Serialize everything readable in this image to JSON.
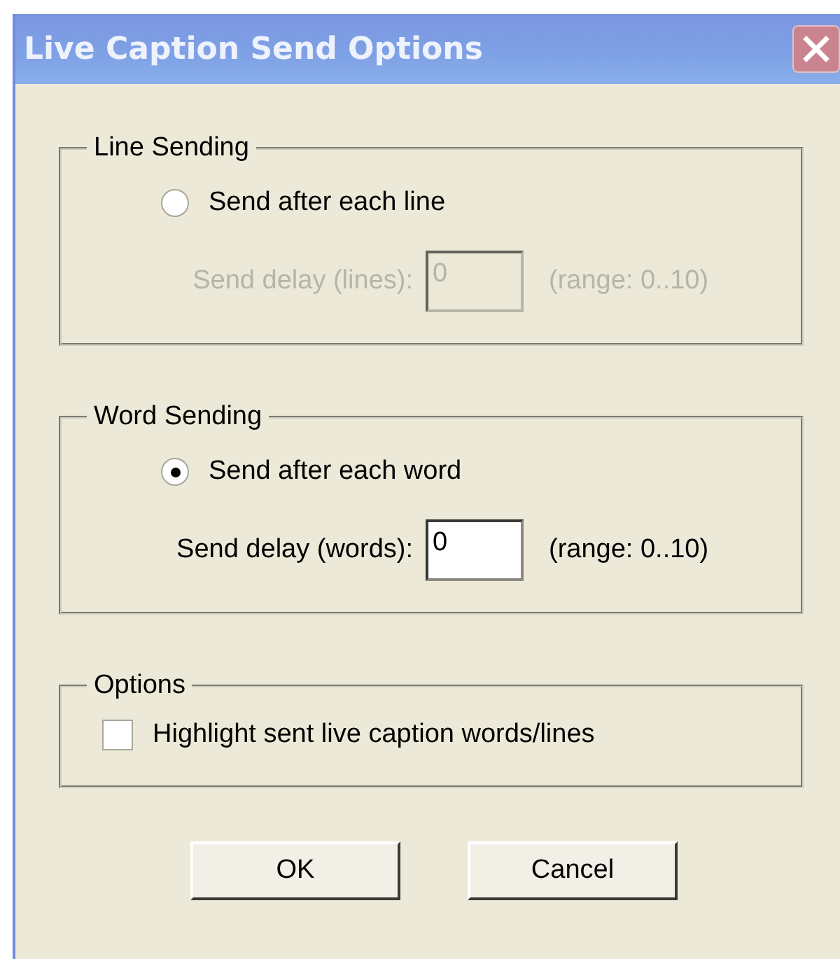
{
  "window": {
    "title": "Live Caption Send Options"
  },
  "groups": [
    {
      "title": "Line Sending",
      "radio": {
        "label": "Send after each line",
        "selected": false
      },
      "delay": {
        "label": "Send delay (lines):",
        "value": "0",
        "range": "(range: 0..10)",
        "disabled": true
      }
    },
    {
      "title": "Word Sending",
      "radio": {
        "label": "Send after each word",
        "selected": true
      },
      "delay": {
        "label": "Send delay (words):",
        "value": "0",
        "range": "(range: 0..10)",
        "disabled": false
      }
    }
  ],
  "options": {
    "title": "Options",
    "checkbox": {
      "label": "Highlight sent live caption words/lines",
      "checked": false
    }
  },
  "buttons": [
    "OK",
    "Cancel"
  ]
}
